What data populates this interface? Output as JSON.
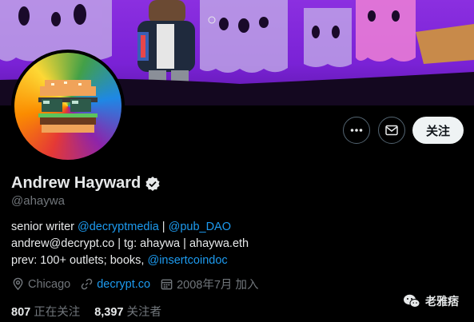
{
  "profile": {
    "name": "Andrew Hayward",
    "handle": "@ahaywa",
    "bio": {
      "line1_prefix": "senior writer ",
      "line1_link1": "@decryptmedia",
      "line1_sep": " | ",
      "line1_link2": "@pub_DAO",
      "line2": "andrew@decrypt.co | tg: ahaywa | ahaywa.eth",
      "line3_prefix": "prev: 100+ outlets; books, ",
      "line3_link": "@insertcoindoc"
    },
    "location": "Chicago",
    "website": "decrypt.co",
    "joined": "2008年7月 加入",
    "following_count": "807",
    "following_label": "正在关注",
    "followers_count": "8,397",
    "followers_label": "关注者"
  },
  "actions": {
    "more_icon": "more-icon",
    "message_icon": "envelope-icon",
    "follow_label": "关注"
  },
  "watermark": {
    "text": "老雅痞"
  },
  "colors": {
    "accent": "#1d9bf0",
    "banner": "#8b2fe0",
    "verified": "#e7e9ea"
  }
}
